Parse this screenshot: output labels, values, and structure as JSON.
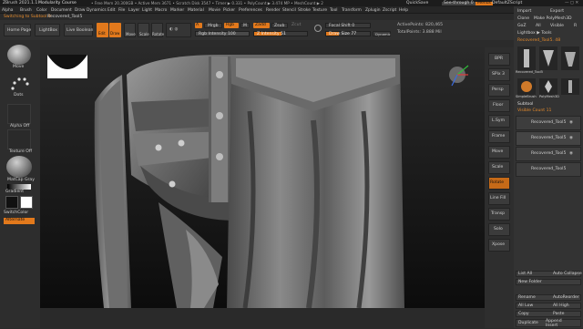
{
  "titlebar": {
    "title": "ZBrush 2021.1.1",
    "project": "Modularity Course",
    "status": "• Free Mem 20.300GB • Active Mem 3671 • Scratch Disk 3547 • Timer ▶ 0.331 • PolyCount ▶ 3.474 MP • MeshCount ▶ 2",
    "quicksave": "QuickSave",
    "seethrough": "See-through 0",
    "menus_label": "Menus",
    "default_script": "DefaultZScript"
  },
  "menubar": {
    "items": [
      "Alpha",
      "Brush",
      "Color",
      "Document",
      "Draw",
      "Dynamics",
      "Edit",
      "File",
      "Layer",
      "Light",
      "Macro",
      "Marker",
      "Material",
      "Movie",
      "Picker",
      "Preferences",
      "Render",
      "Stencil",
      "Stroke",
      "Texture",
      "Tool",
      "Transform",
      "Zplugin",
      "Zscript",
      "Help"
    ]
  },
  "notice": {
    "text": "Switching to Subtool 0:",
    "subtool": "Recovered_Tool5"
  },
  "shelf": {
    "home_page": "Home Page",
    "lightbox": "LightBox",
    "live_boolean": "Live Boolean",
    "edit": "Edit",
    "draw": "Draw",
    "move": "Move",
    "scale": "Scale",
    "rotate": "Rotate",
    "a_label": "A",
    "mrgb": "Mrgb",
    "rgb": "Rgb",
    "m": "M",
    "zadd": "Zadd",
    "zsub": "Zsub",
    "zcut": "Zcut",
    "rgb_intensity": "Rgb Intensity 100",
    "z_intensity": "Z Intensity 51",
    "focal_shift": "Focal Shift 0",
    "draw_size": "Draw Size 77",
    "dynamic": "Dynamic",
    "active_points": "ActivePoints: 820,465",
    "total_points": "TotalPoints: 3.888 Mil"
  },
  "lefttray": {
    "brush": "Move",
    "stroke": "Dots",
    "alpha": "Alpha Off",
    "texture": "Texture Off",
    "material": "MatCap Gray",
    "gradient": "Gradient",
    "switch_color": "SwitchColor",
    "alternate": "Alternate"
  },
  "righttray": {
    "import": "Import",
    "export": "Export",
    "clone": "Clone",
    "make_polymesh": "Make PolyMesh3D",
    "goz": "GoZ",
    "all": "All",
    "visible": "Visible",
    "r": "R",
    "lightbox_tools": "Lightbox ▶ Tools",
    "current_tool": "Recovered_Tool5. 48",
    "tool_thumbs": [
      "Recovered_Tool5",
      "Recovered_Tool5",
      "SimpleBrush",
      "PolyMesh3D",
      "Recovered_Tool5"
    ],
    "subtool_header": "Subtool",
    "visible_count": "Visible Count 11",
    "subtools": [
      "Recovered_Tool5",
      "Recovered_Tool5",
      "Recovered_Tool5",
      "Recovered_Tool5"
    ],
    "list_all": "List All",
    "auto_collapse": "Auto Collapse",
    "new_folder": "New Folder",
    "rename": "Rename",
    "autoreorder": "AutoReorder",
    "all_low": "All Low",
    "all_high": "All High",
    "copy": "Copy",
    "paste": "Paste",
    "duplicate": "Duplicate",
    "append": "Append",
    "insert": "Insert"
  },
  "rightshelf": {
    "labels": [
      "BPR",
      "SPix 3",
      "Persp",
      "Floor",
      "L.Sym",
      "Frame",
      "Move",
      "Scale",
      "Rotate",
      "Line Fill",
      "Transp",
      "Solo",
      "Xpose"
    ]
  },
  "colors": {
    "accent": "#e2791c",
    "bg": "#2b2b2b",
    "panel": "#333333",
    "canvas": "#111111"
  }
}
